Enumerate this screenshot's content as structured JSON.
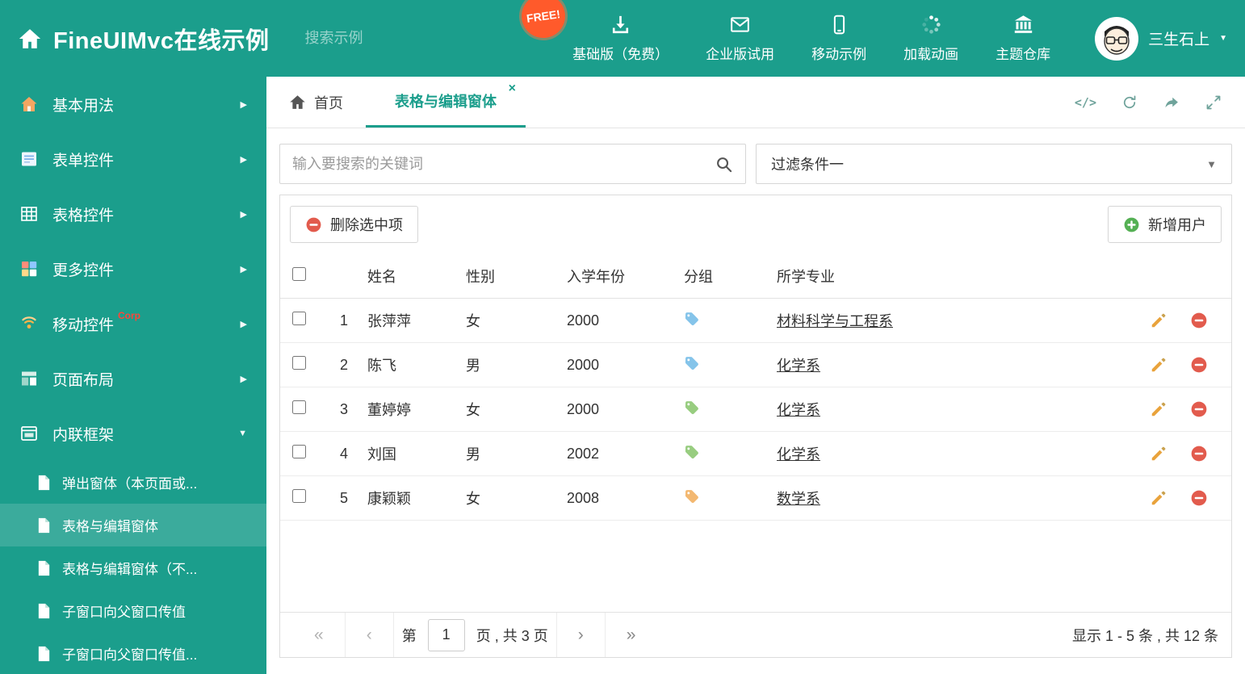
{
  "header": {
    "title": "FineUIMvc在线示例",
    "search_placeholder": "搜索示例",
    "free_badge": "FREE!",
    "nav": [
      {
        "label": "基础版（免费）",
        "icon": "download-icon",
        "name": "basic-free"
      },
      {
        "label": "企业版试用",
        "icon": "envelope-icon",
        "name": "enterprise-trial"
      },
      {
        "label": "移动示例",
        "icon": "mobile-icon",
        "name": "mobile-demo"
      },
      {
        "label": "加载动画",
        "icon": "spinner-icon",
        "name": "loading-animation"
      },
      {
        "label": "主题仓库",
        "icon": "bank-icon",
        "name": "theme-repo"
      }
    ],
    "user_name": "三生石上"
  },
  "sidebar": {
    "items": [
      {
        "label": "基本用法",
        "icon": "house-icon",
        "name": "basic-usage",
        "expanded": false
      },
      {
        "label": "表单控件",
        "icon": "form-icon",
        "name": "form-controls",
        "expanded": false
      },
      {
        "label": "表格控件",
        "icon": "grid-icon",
        "name": "table-controls",
        "expanded": false
      },
      {
        "label": "更多控件",
        "icon": "widgets-icon",
        "name": "more-controls",
        "expanded": false
      },
      {
        "label": "移动控件",
        "badge": "Corp",
        "icon": "signal-icon",
        "name": "mobile-controls",
        "expanded": false
      },
      {
        "label": "页面布局",
        "icon": "layout-icon",
        "name": "page-layout",
        "expanded": false
      },
      {
        "label": "内联框架",
        "icon": "frame-icon",
        "name": "inline-frame",
        "expanded": true
      }
    ],
    "subitems": [
      {
        "label": "弹出窗体（本页面或...",
        "name": "popup-window",
        "active": false
      },
      {
        "label": "表格与编辑窗体",
        "name": "grid-edit-window",
        "active": true
      },
      {
        "label": "表格与编辑窗体（不...",
        "name": "grid-edit-window-alt",
        "active": false
      },
      {
        "label": "子窗口向父窗口传值",
        "name": "child-to-parent",
        "active": false
      },
      {
        "label": "子窗口向父窗口传值...",
        "name": "child-to-parent-alt",
        "active": false
      }
    ]
  },
  "tabs": {
    "home_label": "首页",
    "active_label": "表格与编辑窗体"
  },
  "filter": {
    "search_placeholder": "输入要搜索的关键词",
    "dropdown_value": "过滤条件一"
  },
  "toolbar": {
    "delete_label": "删除选中项",
    "add_label": "新增用户"
  },
  "table": {
    "headers": {
      "name": "姓名",
      "gender": "性别",
      "year": "入学年份",
      "group": "分组",
      "major": "所学专业"
    },
    "rows": [
      {
        "num": "1",
        "name": "张萍萍",
        "gender": "女",
        "year": "2000",
        "tag_color": "#85c4ea",
        "major": "材料科学与工程系"
      },
      {
        "num": "2",
        "name": "陈飞",
        "gender": "男",
        "year": "2000",
        "tag_color": "#85c4ea",
        "major": "化学系"
      },
      {
        "num": "3",
        "name": "董婷婷",
        "gender": "女",
        "year": "2000",
        "tag_color": "#98cd80",
        "major": "化学系"
      },
      {
        "num": "4",
        "name": "刘国",
        "gender": "男",
        "year": "2002",
        "tag_color": "#98cd80",
        "major": "化学系"
      },
      {
        "num": "5",
        "name": "康颖颖",
        "gender": "女",
        "year": "2008",
        "tag_color": "#f3b871",
        "major": "数学系"
      }
    ]
  },
  "pagination": {
    "page_label": "第",
    "page_value": "1",
    "total_label": "页 , 共 3 页",
    "summary": "显示 1 - 5 条 , 共 12 条"
  },
  "colors": {
    "theme": "#1b9e8c",
    "free_badge_bg": "#ff5a2b",
    "delete_red": "#e25b4d",
    "add_green": "#55b054",
    "edit_orange": "#e9a33c"
  }
}
